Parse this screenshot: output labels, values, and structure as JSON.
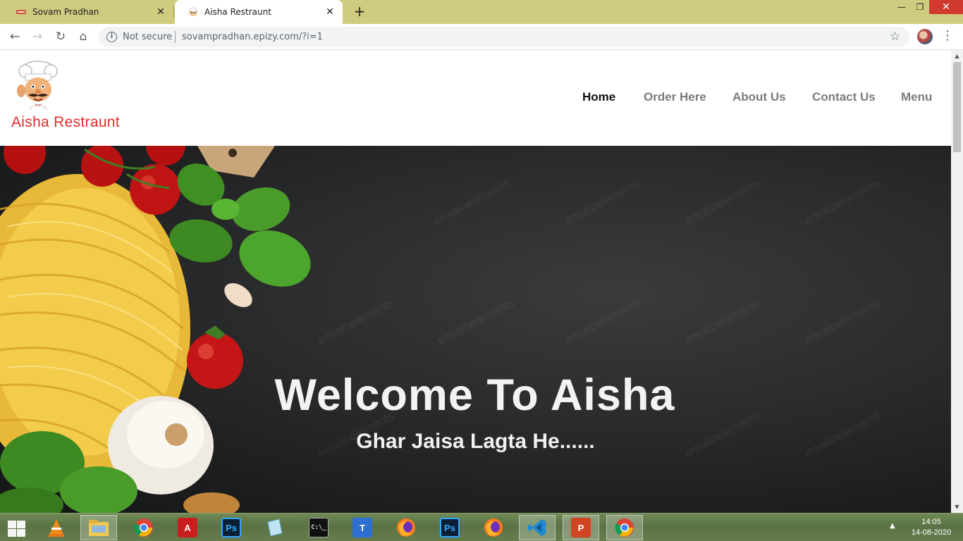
{
  "browser": {
    "tabs": [
      {
        "title": "Sovam Pradhan",
        "active": false
      },
      {
        "title": "Aisha Restraunt",
        "active": true
      }
    ],
    "security_label": "Not secure",
    "url": "sovampradhan.epizy.com/?i=1"
  },
  "site": {
    "brand": "Aisha Restraunt",
    "nav": [
      {
        "label": "Home",
        "active": true
      },
      {
        "label": "Order Here",
        "active": false
      },
      {
        "label": "About Us",
        "active": false
      },
      {
        "label": "Contact Us",
        "active": false
      },
      {
        "label": "Menu",
        "active": false
      }
    ],
    "hero": {
      "title": "Welcome To Aisha",
      "subtitle": "Ghar Jaisa Lagta He......",
      "watermark": "envatoelements"
    }
  },
  "taskbar": {
    "apps": [
      "vlc-icon",
      "file-explorer-icon",
      "chrome-icon",
      "acrobat-icon",
      "photoshop-icon",
      "notes-icon",
      "cmd-icon",
      "typing-tutor-icon",
      "firefox-icon",
      "photoshop-icon",
      "firefox-icon",
      "vscode-icon",
      "powerpoint-icon",
      "chrome-icon"
    ],
    "time": "14:05",
    "date": "14-08-2020"
  },
  "colors": {
    "brand_red": "#e52b2b",
    "tabstrip": "#cfcb7f",
    "nav_active": "#111111",
    "nav_inactive": "#7b7b7b"
  }
}
